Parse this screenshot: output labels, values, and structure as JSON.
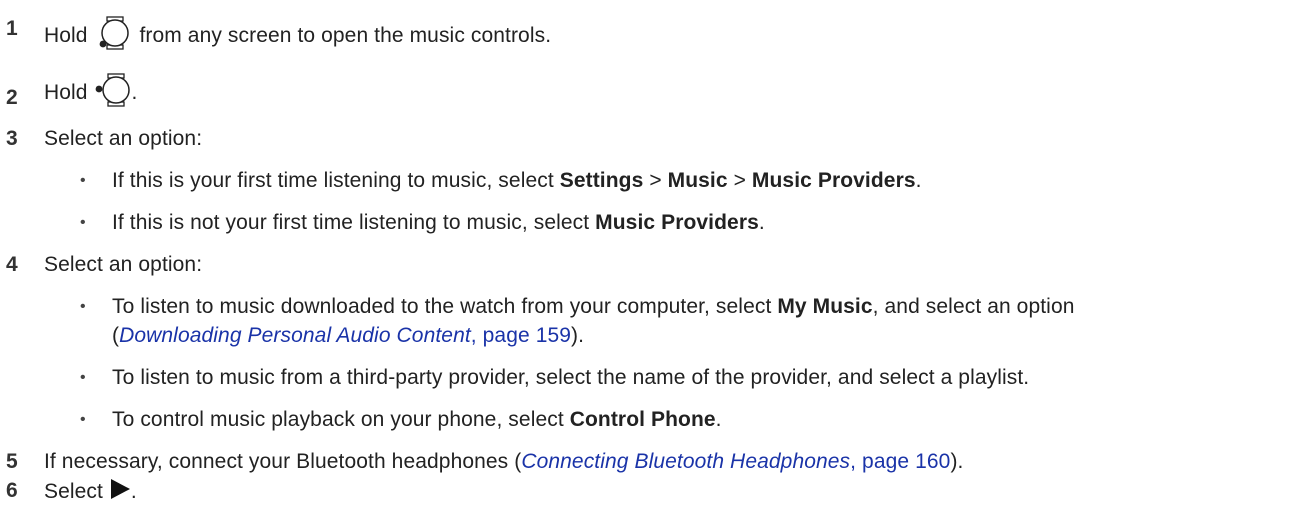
{
  "steps": [
    {
      "num": "1",
      "pre": "Hold",
      "icon": "watch-button-bottom-left-icon",
      "post": "from any screen to open the music controls."
    },
    {
      "num": "2",
      "pre": "Hold",
      "icon": "watch-button-left-icon",
      "post": "."
    },
    {
      "num": "3",
      "text": "Select an option:"
    },
    {
      "num": "4",
      "text": "Select an option:"
    },
    {
      "num": "5",
      "pre": "If necessary, connect your Bluetooth headphones (",
      "link": "Connecting Bluetooth Headphones",
      "link_page": ", page 160",
      "post": ")."
    },
    {
      "num": "6",
      "pre": "Select",
      "icon": "play-icon",
      "post": "."
    }
  ],
  "step3_bullets": [
    {
      "bullet": "•",
      "pre": "If this is your first time listening to music, select",
      "b1": "Settings",
      "sep1": ">",
      "b2": "Music",
      "sep2": ">",
      "b3": "Music Providers",
      "post": "."
    },
    {
      "bullet": "•",
      "pre": "If this is not your first time listening to music, select",
      "b1": "Music Providers",
      "post": "."
    }
  ],
  "step4_bullets": [
    {
      "bullet": "•",
      "pre": "To listen to music downloaded to the watch from your computer, select",
      "b1": "My Music",
      "post": ", and select an option",
      "cont_pre": "(",
      "link": "Downloading Personal Audio Content",
      "link_page": ", page 159",
      "cont_post": ")."
    },
    {
      "bullet": "•",
      "text": "To listen to music from a third-party provider, select the name of the provider, and select a playlist."
    },
    {
      "bullet": "•",
      "pre": "To control music playback on your phone, select",
      "b1": "Control Phone",
      "post": "."
    }
  ],
  "colors": {
    "text": "#222222",
    "link": "#1a33a8"
  }
}
